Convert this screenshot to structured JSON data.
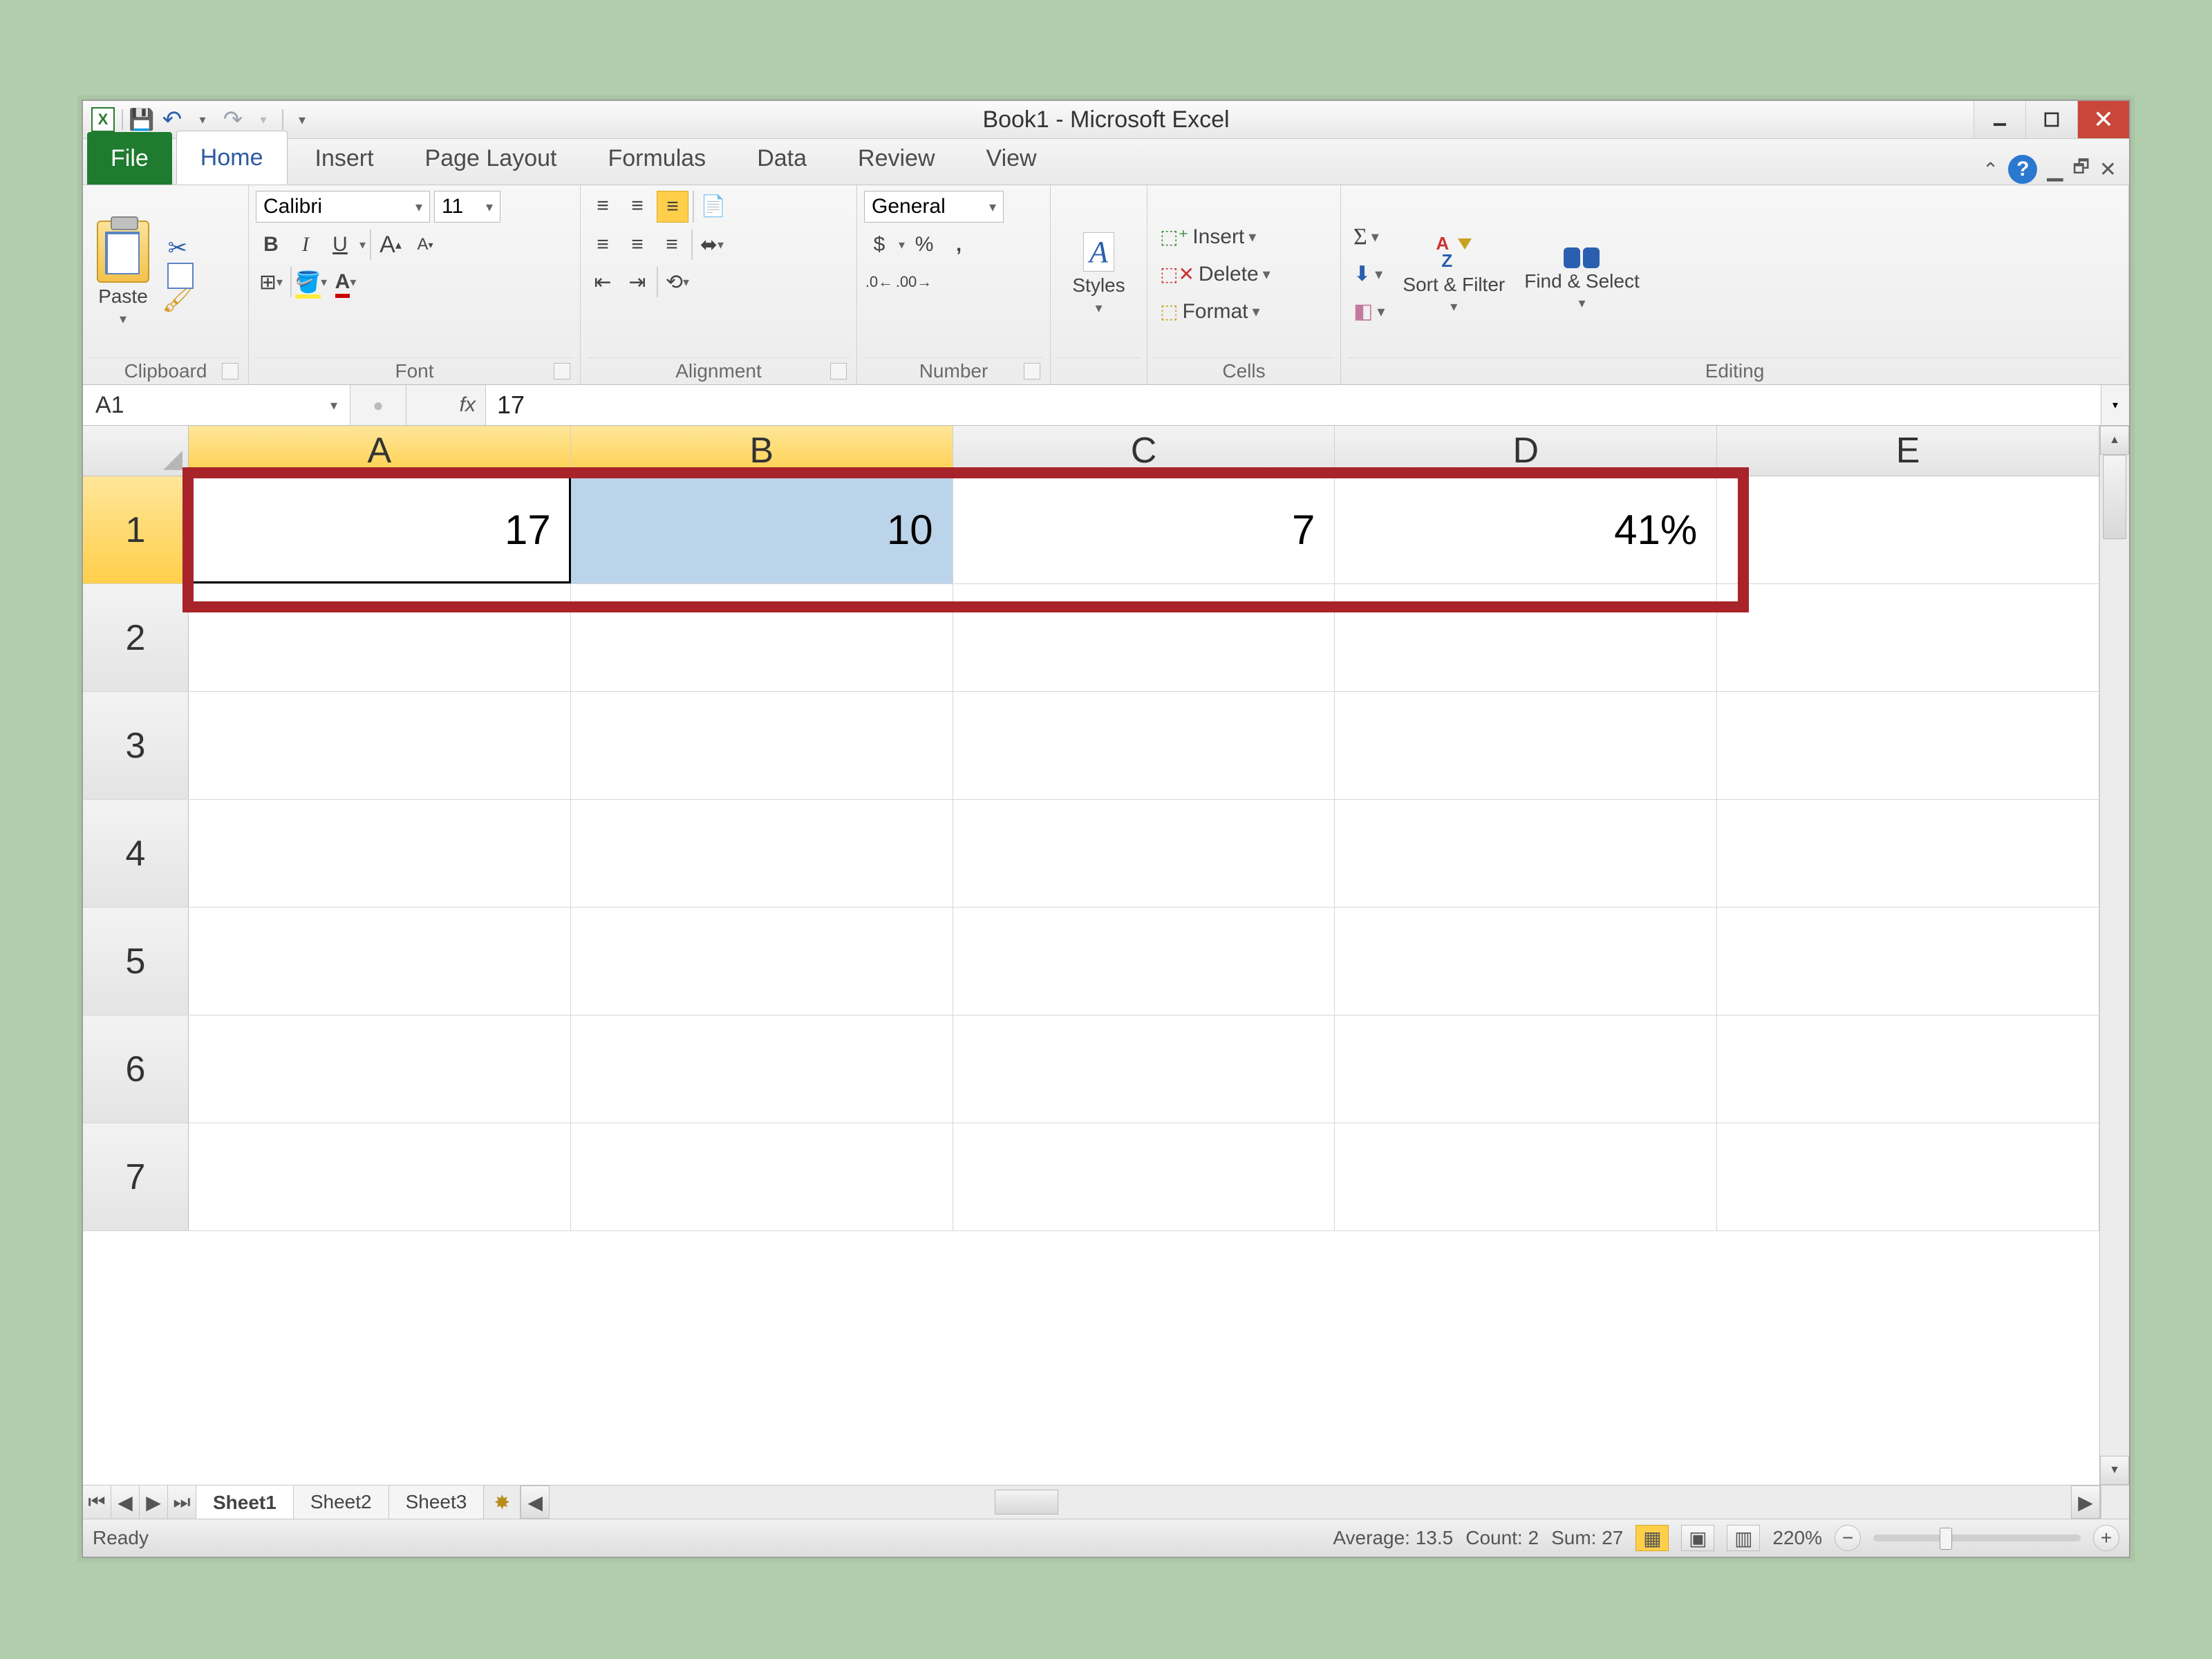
{
  "titlebar": {
    "title": "Book1 - Microsoft Excel",
    "qat": {
      "app": "X",
      "save": "💾",
      "undo": "↶",
      "redo": "↷"
    }
  },
  "tabs": {
    "file": "File",
    "items": [
      "Home",
      "Insert",
      "Page Layout",
      "Formulas",
      "Data",
      "Review",
      "View"
    ],
    "active": "Home"
  },
  "ribbon": {
    "clipboard": {
      "label": "Clipboard",
      "paste": "Paste"
    },
    "font": {
      "label": "Font",
      "font_name": "Calibri",
      "font_size": "11",
      "bold": "B",
      "italic": "I",
      "underline": "U",
      "grow": "A",
      "shrink": "A"
    },
    "alignment": {
      "label": "Alignment"
    },
    "number": {
      "label": "Number",
      "format": "General",
      "currency": "$",
      "percent": "%",
      "comma": ",",
      "inc_dec": "←.0",
      "dec_dec": ".00→"
    },
    "styles": {
      "label": "",
      "btn": "Styles"
    },
    "cells": {
      "label": "Cells",
      "insert": "Insert",
      "delete": "Delete",
      "format": "Format"
    },
    "editing": {
      "label": "Editing",
      "sort": "Sort & Filter",
      "find": "Find & Select"
    }
  },
  "formula_bar": {
    "name_box": "A1",
    "fx": "fx",
    "value": "17"
  },
  "grid": {
    "columns": [
      "A",
      "B",
      "C",
      "D",
      "E"
    ],
    "rows": [
      "1",
      "2",
      "3",
      "4",
      "5",
      "6",
      "7"
    ],
    "selected_cols": [
      "A",
      "B"
    ],
    "selected_row": "1",
    "cells": {
      "A1": "17",
      "B1": "10",
      "C1": "7",
      "D1": "41%"
    }
  },
  "sheet_tabs": {
    "items": [
      "Sheet1",
      "Sheet2",
      "Sheet3"
    ],
    "active": "Sheet1"
  },
  "status": {
    "mode": "Ready",
    "average_label": "Average:",
    "average": "13.5",
    "count_label": "Count:",
    "count": "2",
    "sum_label": "Sum:",
    "sum": "27",
    "zoom": "220%"
  }
}
